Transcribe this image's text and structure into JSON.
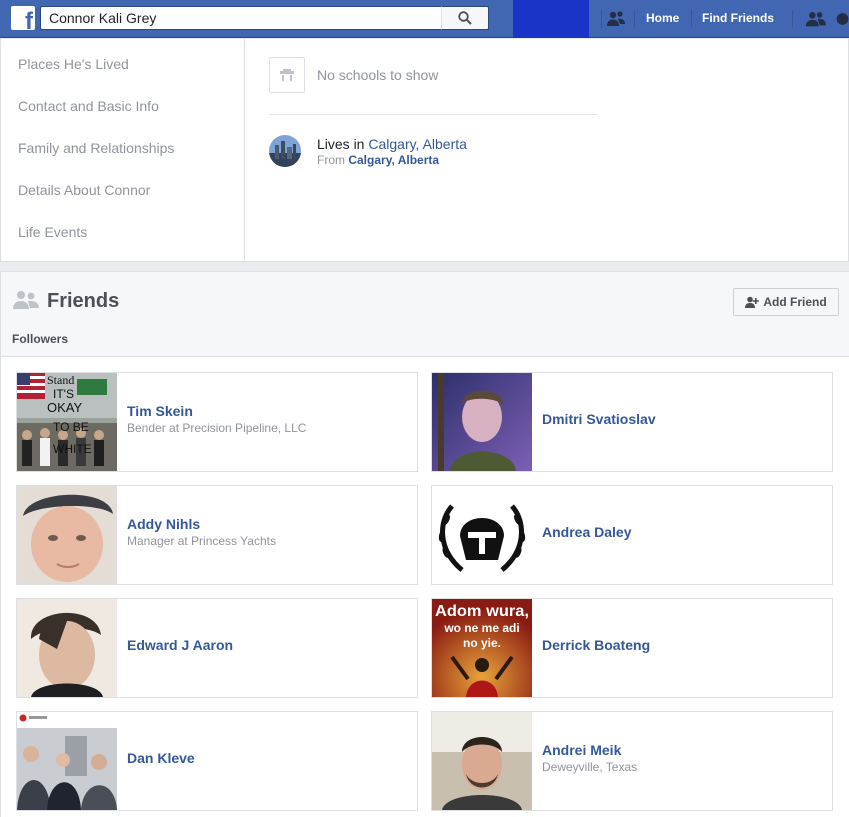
{
  "search": {
    "value": "Connor Kali Grey"
  },
  "topnav": {
    "home": "Home",
    "find_friends": "Find Friends"
  },
  "about": {
    "nav": [
      "Places He's Lived",
      "Contact and Basic Info",
      "Family and Relationships",
      "Details About Connor",
      "Life Events"
    ],
    "no_schools": "No schools to show",
    "lives_prefix": "Lives in ",
    "lives_place": "Calgary, Alberta",
    "from_prefix": "From ",
    "from_place": "Calgary, Alberta"
  },
  "friends": {
    "title": "Friends",
    "add_friend": "Add Friend",
    "tab": "Followers",
    "cards": [
      {
        "name": "Tim Skein",
        "subtitle": "Bender at Precision Pipeline, LLC",
        "photo_text": [
          "Stand",
          "IT'S",
          "OKAY",
          "TO BE",
          "WHITE"
        ]
      },
      {
        "name": "Dmitri Svatioslav",
        "subtitle": ""
      },
      {
        "name": "Addy Nihls",
        "subtitle": "Manager at Princess Yachts"
      },
      {
        "name": "Andrea Daley",
        "subtitle": ""
      },
      {
        "name": "Edward J Aaron",
        "subtitle": ""
      },
      {
        "name": "Derrick Boateng",
        "subtitle": "",
        "photo_text": [
          "Adom wura,",
          "wo ne me adi",
          "no yie."
        ]
      },
      {
        "name": "Dan Kleve",
        "subtitle": ""
      },
      {
        "name": "Andrei Meik",
        "subtitle": "Deweyville, Texas"
      }
    ]
  },
  "colors": {
    "brand": "#4267b2",
    "link": "#365899",
    "muted": "#90949c"
  }
}
